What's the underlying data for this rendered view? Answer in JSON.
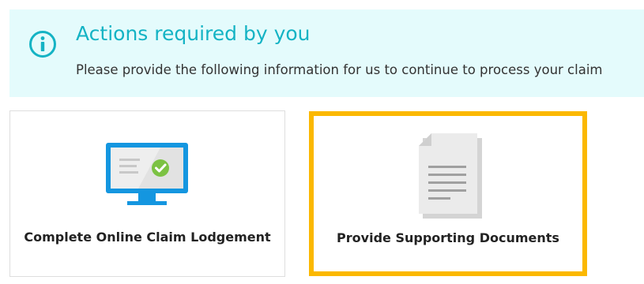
{
  "banner": {
    "icon": "info-icon",
    "title": "Actions required by you",
    "subtitle": "Please provide the following information for us to continue to process your claim",
    "background_color": "#e4fbfc",
    "accent_color": "#14b3c4"
  },
  "actions": [
    {
      "icon": "monitor-check-icon",
      "label": "Complete Online Claim Lodgement",
      "highlighted": false
    },
    {
      "icon": "document-icon",
      "label": "Provide Supporting Documents",
      "highlighted": true,
      "highlight_color": "#fbb800"
    }
  ]
}
